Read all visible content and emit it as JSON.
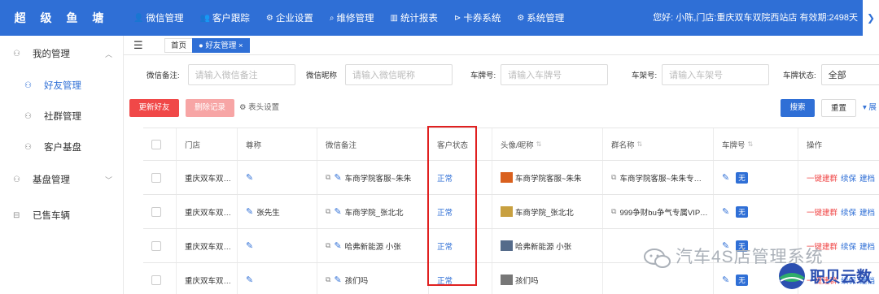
{
  "app": {
    "logo": "超 级 鱼 塘"
  },
  "topnav": [
    {
      "icon": "user-icon",
      "glyph": "👤",
      "label": "微信管理"
    },
    {
      "icon": "follow-icon",
      "glyph": "👥",
      "label": "客户跟踪"
    },
    {
      "icon": "gear-icon",
      "glyph": "⚙",
      "label": "企业设置"
    },
    {
      "icon": "repair-icon",
      "glyph": "⌕",
      "label": "维修管理"
    },
    {
      "icon": "report-icon",
      "glyph": "▥",
      "label": "统计报表"
    },
    {
      "icon": "coupon-icon",
      "glyph": "⊳",
      "label": "卡券系统"
    },
    {
      "icon": "settings-icon",
      "glyph": "⚙",
      "label": "系统管理"
    }
  ],
  "user_info": "您好: 小陈,门店:重庆双车双院西站店 有效期:2498天",
  "top_scroll": "❯",
  "sidebar": {
    "my_manage": "我的管理",
    "friend_manage": "好友管理",
    "community_manage": "社群管理",
    "customer_base": "客户基盘",
    "base_manage": "基盘管理",
    "sold_vehicles": "已售车辆"
  },
  "tabs": {
    "home": "首页",
    "friend": "● 好友管理 ×"
  },
  "filters": {
    "wechat_note_label": "微信备注:",
    "wechat_note_ph": "请输入微信备注",
    "wechat_nick_label": "微信昵称",
    "wechat_nick_ph": "请输入微信昵称",
    "plate_label": "车牌号:",
    "plate_ph": "请输入车牌号",
    "frame_label": "车架号:",
    "frame_ph": "请输入车架号",
    "plate_status_label": "车牌状态:",
    "plate_status_value": "全部"
  },
  "actions": {
    "update": "更新好友",
    "delete": "删除记录",
    "header_settings": "⚙ 表头设置",
    "search": "搜索",
    "reset": "重置",
    "expand": "▾ 展"
  },
  "columns": [
    "门店",
    "尊称",
    "微信备注",
    "客户状态",
    "头像/昵称",
    "群名称",
    "车牌号",
    "操作"
  ],
  "rows": [
    {
      "store": "重庆双车双…",
      "title": "",
      "note": "车商学院客服~朱朱",
      "status": "正常",
      "nick": "车商学院客服~朱朱",
      "group": "车商学院客服~朱朱专…",
      "plate": "无",
      "ops": [
        "一键建群",
        "续保",
        "建档"
      ]
    },
    {
      "store": "重庆双车双…",
      "title": "张先生",
      "note": "车商学院_张北北",
      "status": "正常",
      "nick": "车商学院_张北北",
      "group": "999争财bu争气专属VIP…",
      "plate": "无",
      "ops": [
        "一键建群",
        "续保",
        "建档"
      ]
    },
    {
      "store": "重庆双车双…",
      "title": "",
      "note": "哈弗新能源 小张",
      "status": "正常",
      "nick": "哈弗新能源 小张",
      "group": "",
      "plate": "无",
      "ops": [
        "一键建群",
        "续保",
        "建档"
      ]
    },
    {
      "store": "重庆双车双…",
      "title": "",
      "note": "孩们吗",
      "status": "正常",
      "nick": "孩们吗",
      "group": "",
      "plate": "无",
      "ops": [
        "一键建群",
        "续保",
        "建档"
      ]
    }
  ],
  "watermark": {
    "text": "汽车4S店管理系统",
    "brand": "职贝云数"
  },
  "colors": {
    "primary": "#2f6fd6",
    "danger": "#f04848",
    "danger_light": "#f7a5a5",
    "highlight_box": "#e02020"
  }
}
